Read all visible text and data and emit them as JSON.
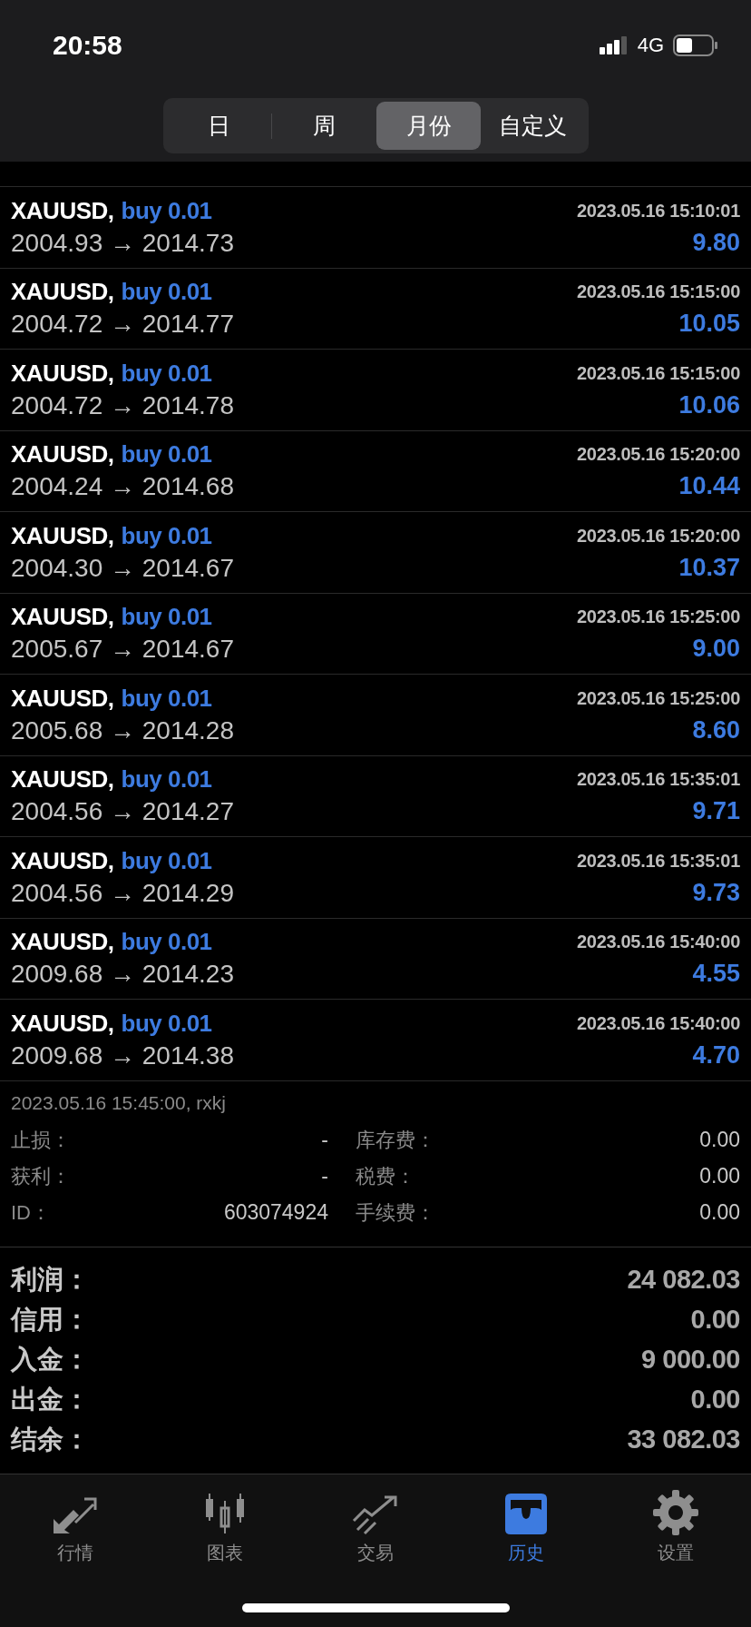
{
  "status_bar": {
    "time": "20:58",
    "network": "4G"
  },
  "periods": [
    {
      "label": "日",
      "selected": false
    },
    {
      "label": "周",
      "selected": false
    },
    {
      "label": "月份",
      "selected": true
    },
    {
      "label": "自定义",
      "selected": false
    }
  ],
  "deals": [
    {
      "symbol": "XAUUSD,",
      "side": "buy 0.01",
      "time": "2023.05.16 15:10:01",
      "prices": "2004.93 → 2014.73",
      "profit": "9.80"
    },
    {
      "symbol": "XAUUSD,",
      "side": "buy 0.01",
      "time": "2023.05.16 15:15:00",
      "prices": "2004.72 → 2014.77",
      "profit": "10.05"
    },
    {
      "symbol": "XAUUSD,",
      "side": "buy 0.01",
      "time": "2023.05.16 15:15:00",
      "prices": "2004.72 → 2014.78",
      "profit": "10.06"
    },
    {
      "symbol": "XAUUSD,",
      "side": "buy 0.01",
      "time": "2023.05.16 15:20:00",
      "prices": "2004.24 → 2014.68",
      "profit": "10.44"
    },
    {
      "symbol": "XAUUSD,",
      "side": "buy 0.01",
      "time": "2023.05.16 15:20:00",
      "prices": "2004.30 → 2014.67",
      "profit": "10.37"
    },
    {
      "symbol": "XAUUSD,",
      "side": "buy 0.01",
      "time": "2023.05.16 15:25:00",
      "prices": "2005.67 → 2014.67",
      "profit": "9.00"
    },
    {
      "symbol": "XAUUSD,",
      "side": "buy 0.01",
      "time": "2023.05.16 15:25:00",
      "prices": "2005.68 → 2014.28",
      "profit": "8.60"
    },
    {
      "symbol": "XAUUSD,",
      "side": "buy 0.01",
      "time": "2023.05.16 15:35:01",
      "prices": "2004.56 → 2014.27",
      "profit": "9.71"
    },
    {
      "symbol": "XAUUSD,",
      "side": "buy 0.01",
      "time": "2023.05.16 15:35:01",
      "prices": "2004.56 → 2014.29",
      "profit": "9.73"
    },
    {
      "symbol": "XAUUSD,",
      "side": "buy 0.01",
      "time": "2023.05.16 15:40:00",
      "prices": "2009.68 → 2014.23",
      "profit": "4.55"
    },
    {
      "symbol": "XAUUSD,",
      "side": "buy 0.01",
      "time": "2023.05.16 15:40:00",
      "prices": "2009.68 → 2014.38",
      "profit": "4.70"
    }
  ],
  "order": {
    "meta": "2023.05.16 15:45:00, rxkj",
    "fields": [
      {
        "label": "止损：",
        "value": "-"
      },
      {
        "label": "库存费：",
        "value": "0.00"
      },
      {
        "label": "获利：",
        "value": "-"
      },
      {
        "label": "税费：",
        "value": "0.00"
      },
      {
        "label": "ID：",
        "value": "603074924"
      },
      {
        "label": "手续费：",
        "value": "0.00"
      }
    ]
  },
  "summary": [
    {
      "label": "利润：",
      "value": "24 082.03"
    },
    {
      "label": "信用：",
      "value": "0.00"
    },
    {
      "label": "入金：",
      "value": "9 000.00"
    },
    {
      "label": "出金：",
      "value": "0.00"
    },
    {
      "label": "结余：",
      "value": "33 082.03"
    }
  ],
  "tabs": [
    {
      "kind": "quotes",
      "label": "行情",
      "selected": false
    },
    {
      "kind": "chart",
      "label": "图表",
      "selected": false
    },
    {
      "kind": "trade",
      "label": "交易",
      "selected": false
    },
    {
      "kind": "history",
      "label": "历史",
      "selected": true
    },
    {
      "kind": "settings",
      "label": "设置",
      "selected": false
    }
  ]
}
